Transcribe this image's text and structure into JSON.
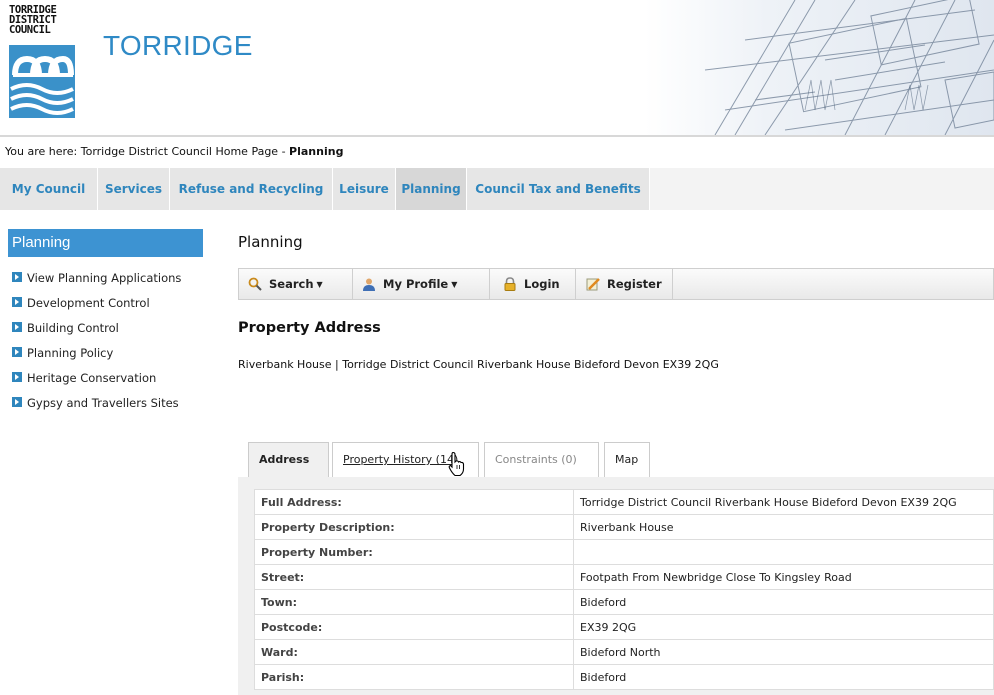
{
  "header": {
    "crest_text": [
      "TORRIDGE",
      "DISTRICT",
      "COUNCIL"
    ],
    "site_title": "TORRIDGE"
  },
  "breadcrumb": {
    "prefix": "You are here: Torridge District Council Home Page - ",
    "current": "Planning"
  },
  "nav": {
    "items": [
      {
        "label": "My Council"
      },
      {
        "label": "Services"
      },
      {
        "label": "Refuse and Recycling"
      },
      {
        "label": "Leisure"
      },
      {
        "label": "Planning",
        "active": true
      },
      {
        "label": "Council Tax and Benefits"
      }
    ]
  },
  "sidebar": {
    "heading": "Planning",
    "items": [
      {
        "label": "View Planning Applications"
      },
      {
        "label": "Development Control"
      },
      {
        "label": "Building Control"
      },
      {
        "label": "Planning Policy"
      },
      {
        "label": "Heritage Conservation"
      },
      {
        "label": "Gypsy and Travellers Sites"
      }
    ]
  },
  "main": {
    "heading": "Planning",
    "toolbar": {
      "search": "Search",
      "my_profile": "My Profile",
      "login": "Login",
      "register": "Register"
    },
    "section_heading": "Property Address",
    "address_line": "Riverbank House | Torridge District Council Riverbank House Bideford Devon EX39 2QG",
    "tabs": [
      {
        "label": "Address",
        "active": true
      },
      {
        "label": "Property History (14)"
      },
      {
        "label": "Constraints (0)",
        "disabled": true
      },
      {
        "label": "Map"
      }
    ],
    "details": [
      {
        "label": "Full Address:",
        "value": "Torridge District Council Riverbank House Bideford Devon EX39 2QG"
      },
      {
        "label": "Property Description:",
        "value": "Riverbank House"
      },
      {
        "label": "Property Number:",
        "value": ""
      },
      {
        "label": "Street:",
        "value": "Footpath From Newbridge Close To Kingsley Road"
      },
      {
        "label": "Town:",
        "value": "Bideford"
      },
      {
        "label": "Postcode:",
        "value": "EX39 2QG"
      },
      {
        "label": "Ward:",
        "value": "Bideford North"
      },
      {
        "label": "Parish:",
        "value": "Bideford"
      }
    ]
  },
  "colors": {
    "brand_blue": "#2f8ac6",
    "sidebar_head": "#3d93d2",
    "nav_link": "#2f86bd"
  }
}
